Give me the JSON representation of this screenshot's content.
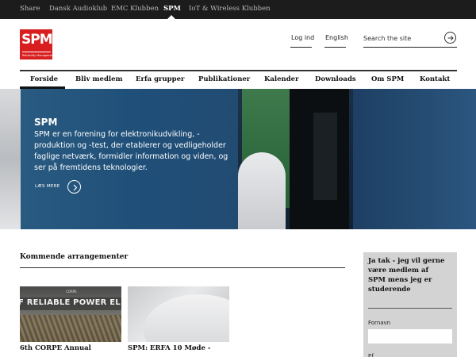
{
  "topbar": {
    "items": [
      "Share",
      "Dansk Audioklub",
      "EMC Klubben",
      "SPM",
      "IoT & Wireless Klubben"
    ]
  },
  "header": {
    "logo_text": "SPM",
    "logo_subtext": "Reliability Management",
    "login": "Log ind",
    "language": "English",
    "search_placeholder": "Search the site",
    "search_icon": "arrow-right-circle-icon"
  },
  "nav": {
    "items": [
      "Forside",
      "Bliv medlem",
      "Erfa grupper",
      "Publikationer",
      "Kalender",
      "Downloads",
      "Om SPM",
      "Kontakt"
    ],
    "active": "Forside"
  },
  "hero": {
    "title": "SPM",
    "text": "SPM er en forening for elektronikudvikling, -produktion og -test, der etablerer og vedligeholder faglige netværk, formidler information og viden, og ser på fremtidens teknologier.",
    "more_label": "LÆS MERE",
    "more_icon": "chevron-right-circle-icon"
  },
  "events": {
    "heading": "Kommende arrangementer",
    "cards": [
      {
        "title": "6th CORPE Annual",
        "image_text": "F RELIABLE POWER EL",
        "image_subtext": "CORPE"
      },
      {
        "title": "SPM: ERFA 10 Møde -"
      }
    ]
  },
  "signup": {
    "title": "Ja tak - jeg vil gerne være medlem af SPM mens jeg er studerende",
    "field1_label": "Fornavn",
    "field1_value": "",
    "field2_label": "Ef"
  },
  "colors": {
    "topbar_bg": "#1c1c1c",
    "logo_red": "#d81e1e",
    "hero_blue": "#1f4f78",
    "sidebar_bg": "#d3d3d3"
  }
}
